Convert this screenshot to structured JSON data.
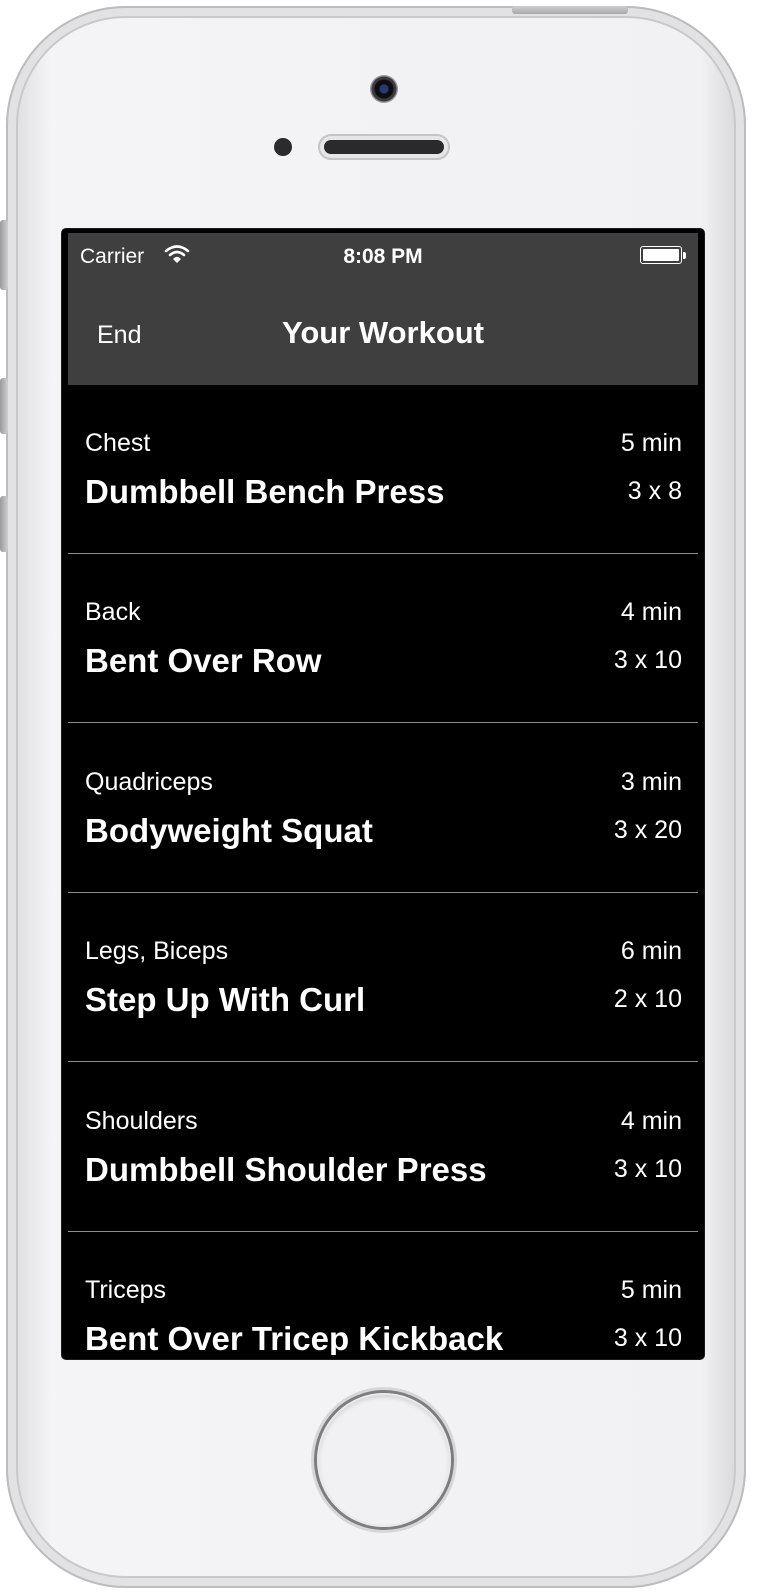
{
  "status_bar": {
    "carrier": "Carrier",
    "time": "8:08 PM"
  },
  "nav": {
    "end_label": "End",
    "title": "Your Workout"
  },
  "exercises": [
    {
      "muscle": "Chest",
      "name": "Dumbbell Bench Press",
      "duration": "5 min",
      "sets": "3 x 8"
    },
    {
      "muscle": "Back",
      "name": "Bent Over Row",
      "duration": "4 min",
      "sets": "3 x 10"
    },
    {
      "muscle": "Quadriceps",
      "name": "Bodyweight Squat",
      "duration": "3 min",
      "sets": "3 x 20"
    },
    {
      "muscle": "Legs, Biceps",
      "name": "Step Up With Curl",
      "duration": "6 min",
      "sets": "2 x 10"
    },
    {
      "muscle": "Shoulders",
      "name": "Dumbbell Shoulder Press",
      "duration": "4 min",
      "sets": "3 x 10"
    },
    {
      "muscle": "Triceps",
      "name": "Bent Over Tricep Kickback",
      "duration": "5 min",
      "sets": "3 x 10"
    }
  ],
  "colors": {
    "nav_background": "#3f3f3f",
    "list_background": "#000000",
    "separator": "#8e8e8e",
    "text": "#ffffff"
  }
}
